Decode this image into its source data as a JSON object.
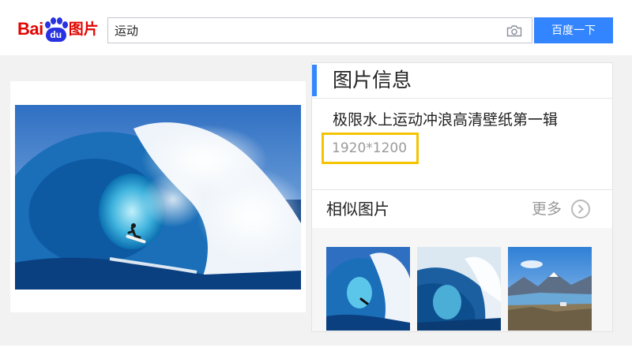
{
  "header": {
    "logo_bai": "Bai",
    "logo_du": "du",
    "logo_pictures": "图片",
    "search": {
      "value": "运动"
    },
    "search_button_label": "百度一下",
    "camera_icon": "camera-icon"
  },
  "info_panel": {
    "title": "图片信息",
    "image_title": "极限水上运动冲浪高清壁纸第一辑",
    "image_size": "1920*1200"
  },
  "similar": {
    "title": "相似图片",
    "more_label": "更多",
    "thumbnails": [
      "surfer-wave-thumbnail",
      "wave-thumbnail",
      "mountain-lake-thumbnail"
    ]
  },
  "colors": {
    "brand_red": "#e10602",
    "brand_blue": "#2932e1",
    "search_button": "#3385ff",
    "accent_bar": "#3388ff",
    "highlight_box": "#f5c400"
  }
}
